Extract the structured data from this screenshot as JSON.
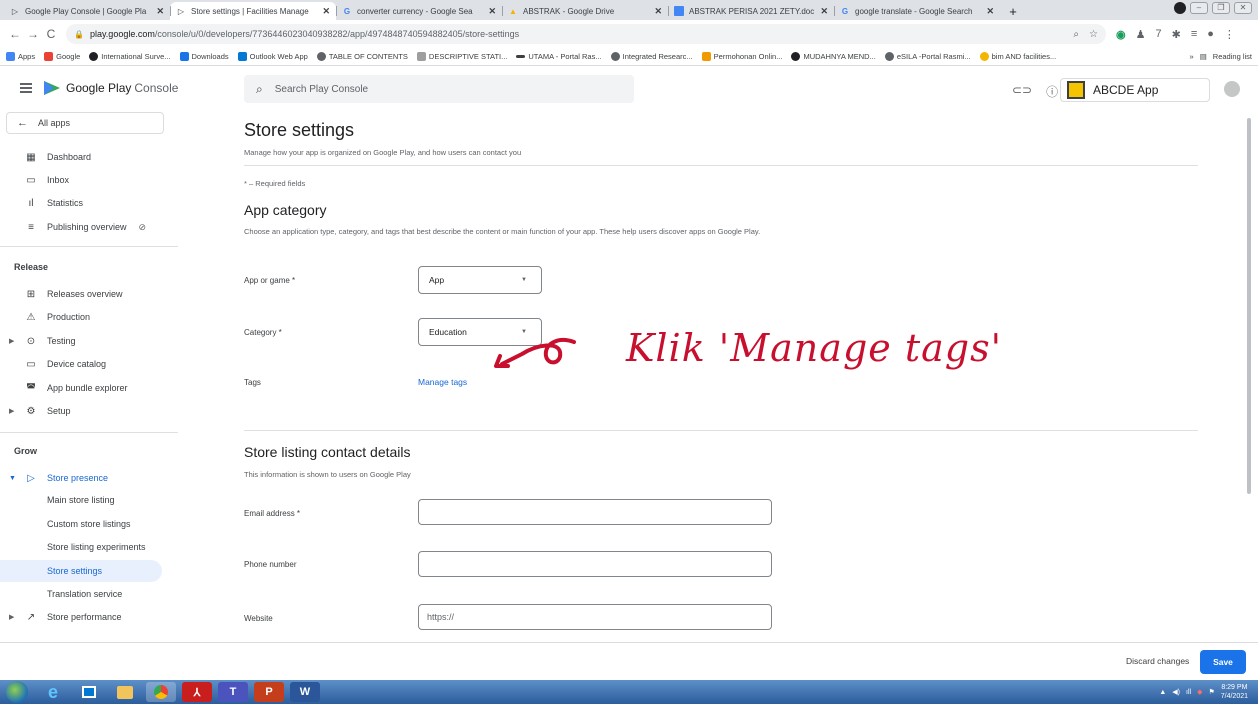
{
  "browser": {
    "tabs": [
      {
        "title": "Google Play Console | Google Pla",
        "active": false
      },
      {
        "title": "Store settings | Facilities Manage",
        "active": true
      },
      {
        "title": "converter currency - Google Sea",
        "active": false
      },
      {
        "title": "ABSTRAK - Google Drive",
        "active": false
      },
      {
        "title": "ABSTRAK PERISA 2021 ZETY.doc",
        "active": false
      },
      {
        "title": "google translate - Google Search",
        "active": false
      }
    ],
    "url_host": "play.google.com",
    "url_path": "/console/u/0/developers/7736446023040938282/app/4974848740594882405/store-settings",
    "bookmarks": [
      "Apps",
      "Google",
      "International Surve...",
      "Downloads",
      "Outlook Web App",
      "TABLE OF CONTENTS",
      "DESCRIPTIVE STATI...",
      "UTAMA - Portal Ras...",
      "Integrated Researc...",
      "Permohonan Onlin...",
      "MUDAHNYA MEND...",
      "eSILA -Portal Rasmi...",
      "bim AND facilities..."
    ],
    "reading_list": "Reading list"
  },
  "header": {
    "logo_google_play": "Google Play",
    "logo_console": "Console",
    "search_placeholder": "Search Play Console",
    "app_name": "ABCDE App"
  },
  "sidebar": {
    "all_apps": "All apps",
    "items_top": [
      {
        "label": "Dashboard",
        "icon": "dashboard-icon"
      },
      {
        "label": "Inbox",
        "icon": "inbox-icon"
      },
      {
        "label": "Statistics",
        "icon": "statistics-icon"
      },
      {
        "label": "Publishing overview",
        "icon": "publishing-icon"
      }
    ],
    "release_label": "Release",
    "release_items": [
      {
        "label": "Releases overview"
      },
      {
        "label": "Production"
      },
      {
        "label": "Testing"
      },
      {
        "label": "Device catalog"
      },
      {
        "label": "App bundle explorer"
      },
      {
        "label": "Setup"
      }
    ],
    "grow_label": "Grow",
    "store_presence": "Store presence",
    "store_presence_sub": [
      {
        "label": "Main store listing"
      },
      {
        "label": "Custom store listings"
      },
      {
        "label": "Store listing experiments"
      },
      {
        "label": "Store settings"
      },
      {
        "label": "Translation service"
      }
    ],
    "store_performance": "Store performance"
  },
  "main": {
    "title": "Store settings",
    "subtitle": "Manage how your app is organized on Google Play, and how users can contact you",
    "required_note": "* – Required fields",
    "app_category": {
      "title": "App category",
      "description": "Choose an application type, category, and tags that best describe the content or main function of your app. These help users discover apps on Google Play.",
      "app_or_game_label": "App or game *",
      "app_or_game_value": "App",
      "category_label": "Category *",
      "category_value": "Education",
      "tags_label": "Tags",
      "manage_tags": "Manage tags"
    },
    "contact": {
      "title": "Store listing contact details",
      "description": "This information is shown to users on Google Play",
      "email_label": "Email address *",
      "phone_label": "Phone number",
      "website_label": "Website",
      "website_placeholder": "https://"
    },
    "annotation": "Klik 'Manage tags'"
  },
  "actions": {
    "discard": "Discard changes",
    "save": "Save"
  },
  "taskbar": {
    "time": "8:29 PM",
    "date": "7/4/2021"
  },
  "colors": {
    "accent": "#1a73e8",
    "active_nav": "#1967d2",
    "annotation": "#c8102e"
  }
}
